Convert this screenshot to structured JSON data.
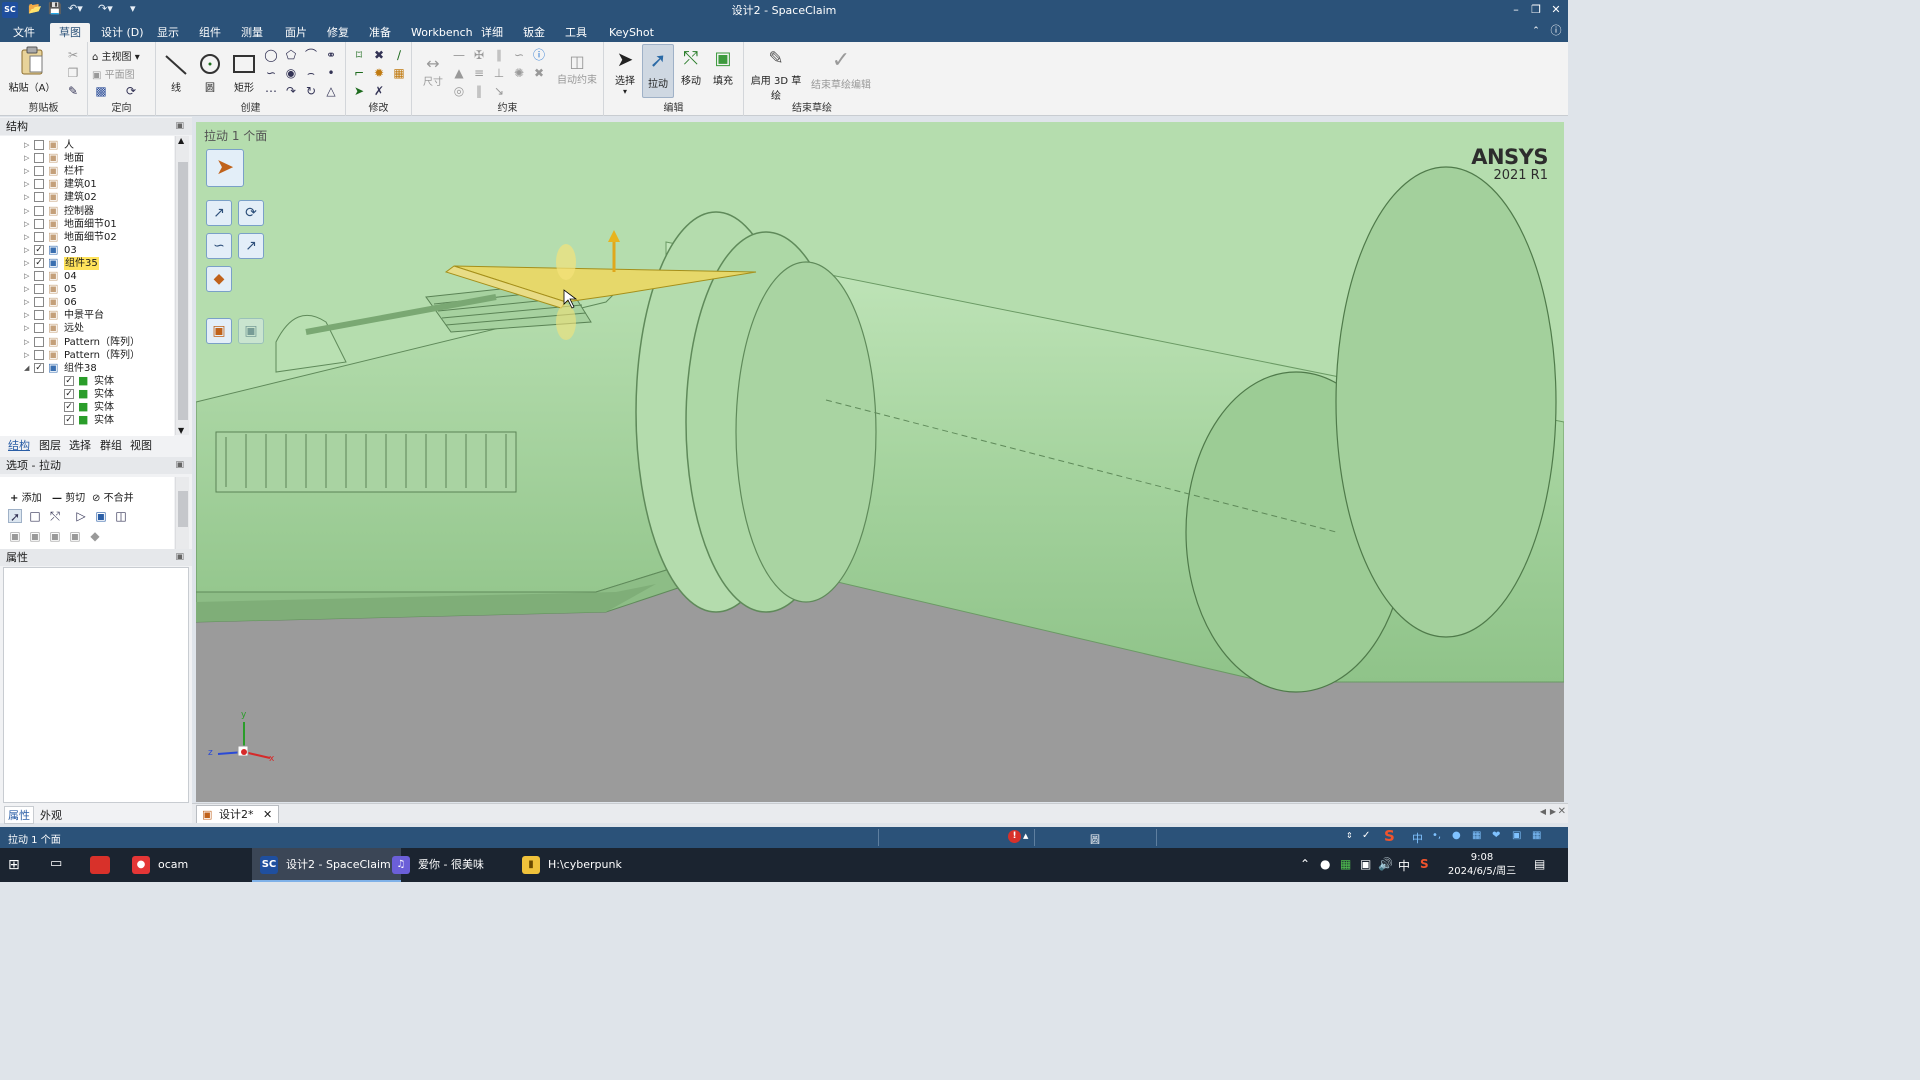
{
  "titlebar": {
    "app_logo": "SC",
    "title": "设计2 - SpaceClaim"
  },
  "menu_tabs": [
    {
      "label": "文件",
      "active": false
    },
    {
      "label": "草图",
      "active": true
    },
    {
      "label": "设计 (D)",
      "active": false
    },
    {
      "label": "显示",
      "active": false
    },
    {
      "label": "组件",
      "active": false
    },
    {
      "label": "测量",
      "active": false
    },
    {
      "label": "面片",
      "active": false
    },
    {
      "label": "修复",
      "active": false
    },
    {
      "label": "准备",
      "active": false
    },
    {
      "label": "Workbench",
      "active": false
    },
    {
      "label": "详细",
      "active": false
    },
    {
      "label": "钣金",
      "active": false
    },
    {
      "label": "工具",
      "active": false
    },
    {
      "label": "KeyShot",
      "active": false
    }
  ],
  "ribbon": {
    "clipboard": {
      "group_label": "剪贴板",
      "paste_label": "粘贴（A）"
    },
    "orient": {
      "group_label": "定向",
      "home_view": "主视图",
      "plane_view": "平面图"
    },
    "create": {
      "group_label": "创建",
      "line": "线",
      "circle": "圆",
      "rect": "矩形"
    },
    "modify": {
      "group_label": "修改"
    },
    "constrain": {
      "group_label": "约束",
      "dimension": "尺寸",
      "auto_constrain": "自动约束"
    },
    "edit": {
      "group_label": "编辑",
      "select": "选择",
      "pull": "拉动",
      "move": "移动",
      "fill": "填充"
    },
    "end_sketch": {
      "group_label": "结束草绘",
      "start_3d": "启用 3D 草绘",
      "end_edit": "结束草绘编辑"
    }
  },
  "structure_panel": {
    "header": "结构",
    "items": [
      {
        "label": "人",
        "checked": false,
        "expanded": false,
        "indent": 0
      },
      {
        "label": "地面",
        "checked": false,
        "expanded": false,
        "indent": 0
      },
      {
        "label": "栏杆",
        "checked": false,
        "expanded": false,
        "indent": 0
      },
      {
        "label": "建筑01",
        "checked": false,
        "expanded": false,
        "indent": 0
      },
      {
        "label": "建筑02",
        "checked": false,
        "expanded": false,
        "indent": 0
      },
      {
        "label": "控制器",
        "checked": false,
        "expanded": false,
        "indent": 0
      },
      {
        "label": "地面细节01",
        "checked": false,
        "expanded": false,
        "indent": 0
      },
      {
        "label": "地面细节02",
        "checked": false,
        "expanded": false,
        "indent": 0
      },
      {
        "label": "03",
        "checked": true,
        "expanded": false,
        "indent": 0
      },
      {
        "label": "组件35",
        "checked": true,
        "expanded": false,
        "indent": 0,
        "highlight": true
      },
      {
        "label": "04",
        "checked": false,
        "expanded": false,
        "indent": 0
      },
      {
        "label": "05",
        "checked": false,
        "expanded": false,
        "indent": 0
      },
      {
        "label": "06",
        "checked": false,
        "expanded": false,
        "indent": 0
      },
      {
        "label": "中景平台",
        "checked": false,
        "expanded": false,
        "indent": 0
      },
      {
        "label": "远处",
        "checked": false,
        "expanded": false,
        "indent": 0
      },
      {
        "label": "Pattern（阵列）",
        "checked": false,
        "expanded": false,
        "indent": 0
      },
      {
        "label": "Pattern（阵列）",
        "checked": false,
        "expanded": false,
        "indent": 0
      },
      {
        "label": "组件38",
        "checked": true,
        "expanded": true,
        "indent": 0
      },
      {
        "label": "实体",
        "checked": true,
        "expanded": false,
        "indent": 1,
        "solid": true
      },
      {
        "label": "实体",
        "checked": true,
        "expanded": false,
        "indent": 1,
        "solid": true
      },
      {
        "label": "实体",
        "checked": true,
        "expanded": false,
        "indent": 1,
        "solid": true
      },
      {
        "label": "实体",
        "checked": true,
        "expanded": false,
        "indent": 1,
        "solid": true
      }
    ],
    "tabs": [
      "结构",
      "图层",
      "选择",
      "群组",
      "视图"
    ]
  },
  "options_panel": {
    "header": "选项 - 拉动",
    "add": "添加",
    "cut": "剪切",
    "no_merge": "不合并"
  },
  "properties_panel": {
    "header": "属性",
    "tabs": [
      "属性",
      "外观"
    ]
  },
  "viewport": {
    "mode_label": "拉动 1 个面",
    "brand": "ANSYS",
    "version": "2021 R1",
    "axis_x": "x",
    "axis_y": "y",
    "axis_z": "z",
    "colors": {
      "model": "#a9d6a3",
      "background": "#9b9b9b",
      "selection": "#e6d86a"
    }
  },
  "doc_tab": {
    "label": "设计2*"
  },
  "statusbar": {
    "message": "拉动 1 个面",
    "error_count": "!",
    "mode_glyph": "圆"
  },
  "taskbar": {
    "tasks": [
      {
        "label": "ocam",
        "active": false
      },
      {
        "label": "设计2 - SpaceClaim",
        "active": true
      },
      {
        "label": "爱你 - 很美味",
        "active": false
      },
      {
        "label": "H:\\cyberpunk",
        "active": false
      }
    ],
    "ime": "中",
    "time": "9:08",
    "date": "2024/6/5/周三"
  }
}
